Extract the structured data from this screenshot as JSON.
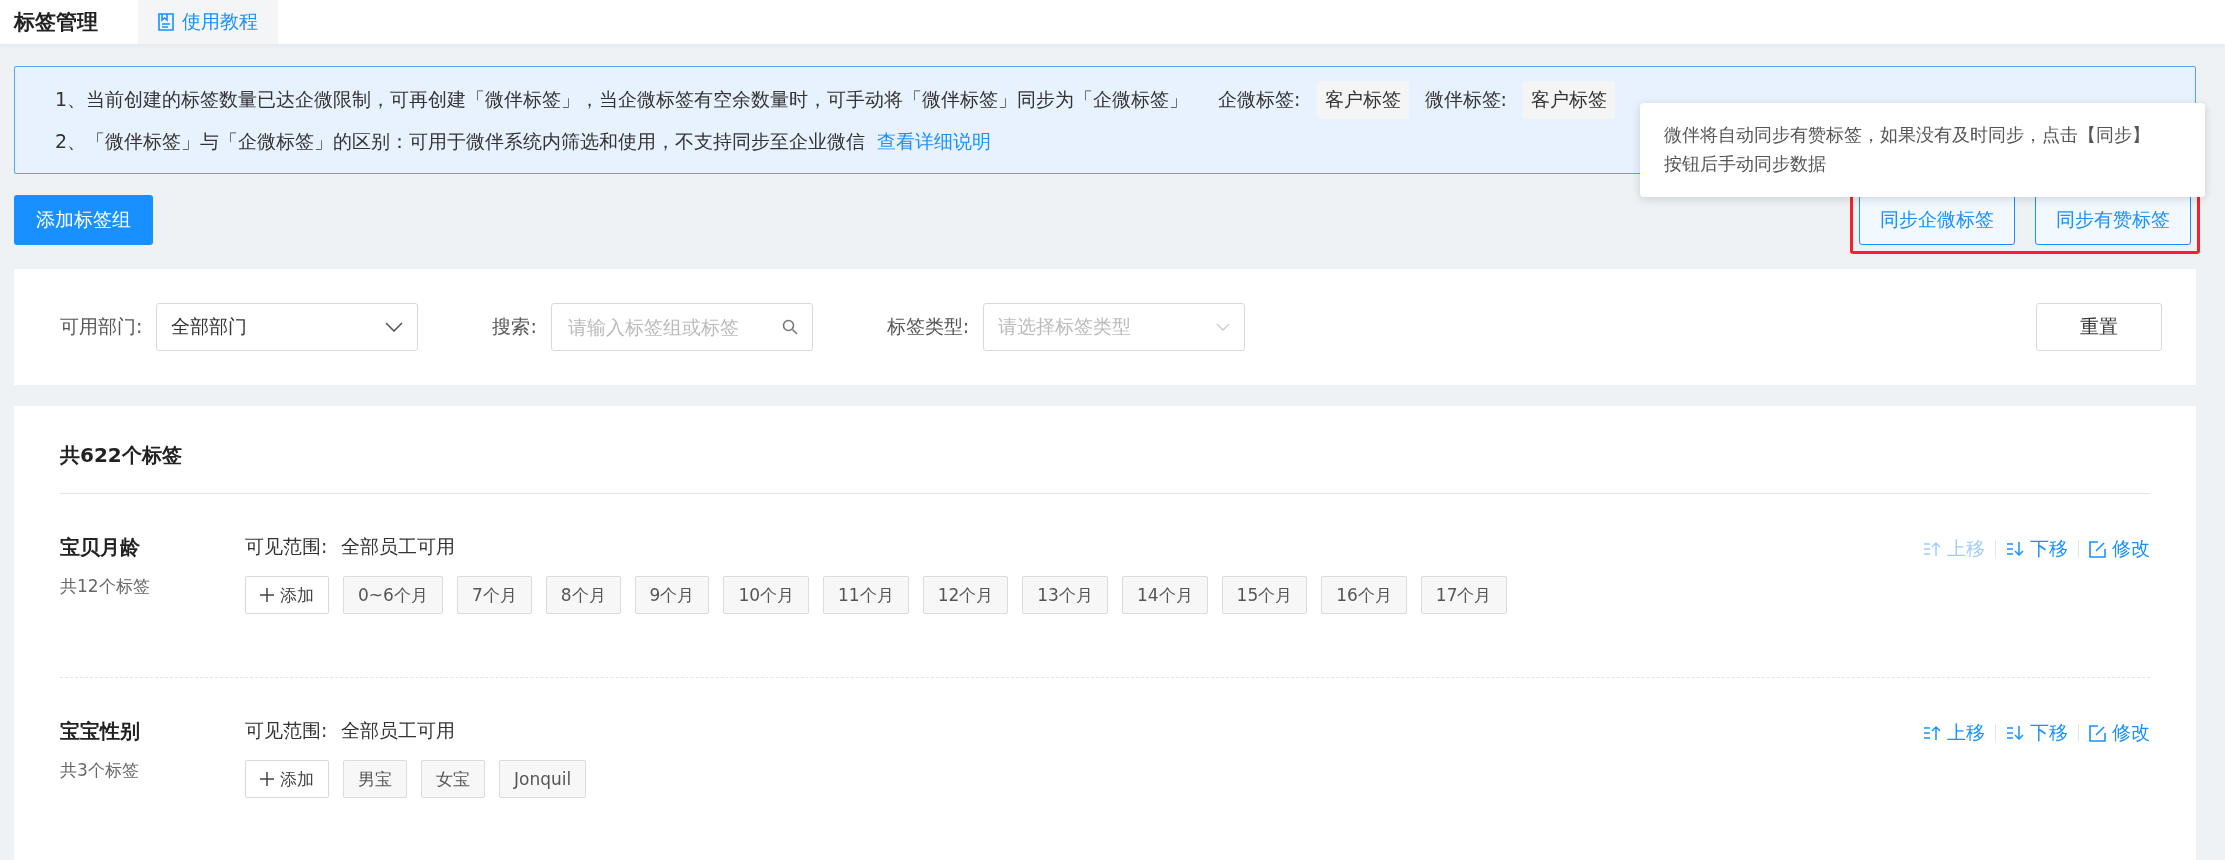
{
  "header": {
    "title": "标签管理",
    "tutorial_tab": "使用教程"
  },
  "notice": {
    "line1": "1、当前创建的标签数量已达企微限制，可再创建「微伴标签」，当企微标签有空余数量时，可手动将「微伴标签」同步为「企微标签」",
    "legend": [
      {
        "label": "企微标签:",
        "tag": "客户标签"
      },
      {
        "label": "微伴标签:",
        "tag": "客户标签"
      }
    ],
    "line2": "2、「微伴标签」与「企微标签」的区别：可用于微伴系统内筛选和使用，不支持同步至企业微信",
    "link": "查看详细说明"
  },
  "add_group_button": "添加标签组",
  "tooltip": {
    "lines": [
      "微伴将自动同步有赞标签，如果没有及时同步，点击【同步】",
      "按钮后手动同步数据"
    ]
  },
  "sync_buttons": [
    "同步企微标签",
    "同步有赞标签"
  ],
  "filters": {
    "department": {
      "label": "可用部门:",
      "value": "全部部门"
    },
    "search": {
      "label": "搜索:",
      "placeholder": "请输入标签组或标签"
    },
    "type": {
      "label": "标签类型:",
      "placeholder": "请选择标签类型"
    },
    "reset": "重置"
  },
  "total": "共622个标签",
  "groups": [
    {
      "name": "宝贝月龄",
      "count": "共12个标签",
      "scope_label": "可见范围:",
      "scope": "全部员工可用",
      "add": "添加",
      "tags": [
        "0~6个月",
        "7个月",
        "8个月",
        "9个月",
        "10个月",
        "11个月",
        "12个月",
        "13个月",
        "14个月",
        "15个月",
        "16个月",
        "17个月"
      ],
      "move_up": {
        "label": "上移",
        "disabled": true
      },
      "move_down": {
        "label": "下移",
        "disabled": false
      },
      "edit": "修改"
    },
    {
      "name": "宝宝性别",
      "count": "共3个标签",
      "scope_label": "可见范围:",
      "scope": "全部员工可用",
      "add": "添加",
      "tags": [
        "男宝",
        "女宝",
        "Jonquil"
      ],
      "move_up": {
        "label": "上移",
        "disabled": false
      },
      "move_down": {
        "label": "下移",
        "disabled": false
      },
      "edit": "修改"
    }
  ]
}
